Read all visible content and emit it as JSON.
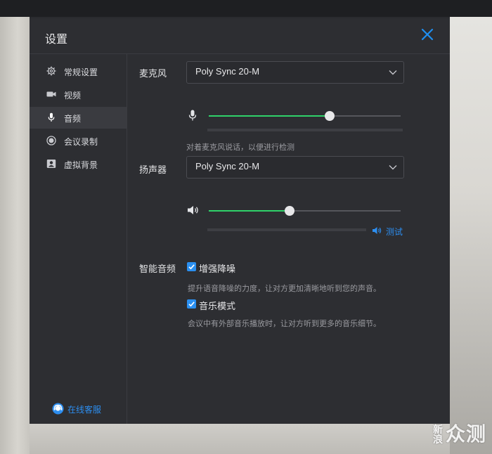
{
  "dialog": {
    "title": "设置"
  },
  "sidebar": {
    "items": [
      {
        "label": "常规设置",
        "icon": "gear-icon"
      },
      {
        "label": "视频",
        "icon": "video-icon"
      },
      {
        "label": "音频",
        "icon": "microphone-icon"
      },
      {
        "label": "会议录制",
        "icon": "record-icon"
      },
      {
        "label": "虚拟背景",
        "icon": "portrait-icon"
      }
    ],
    "active": "音频",
    "support_label": "在线客服"
  },
  "audio": {
    "microphone": {
      "label": "麦克风",
      "device": "Poly Sync 20-M",
      "volume_fraction": 0.63,
      "hint": "对着麦克风说话，以便进行检测"
    },
    "speaker": {
      "label": "扬声器",
      "device": "Poly Sync 20-M",
      "volume_fraction": 0.42,
      "test_label": "测试"
    },
    "smart_audio": {
      "label": "智能音频",
      "options": [
        {
          "label": "增强降噪",
          "checked": true,
          "hint": "提升语音降噪的力度，让对方更加清晰地听到您的声音。"
        },
        {
          "label": "音乐模式",
          "checked": true,
          "hint": "会议中有外部音乐播放时，让对方听到更多的音乐细节。"
        }
      ]
    }
  },
  "colors": {
    "accent": "#2a8ff0",
    "slider_fill": "#2fd26a",
    "panel_bg": "#2d2e32"
  },
  "watermark": {
    "line1": "新",
    "line2": "浪",
    "text": "众测"
  }
}
